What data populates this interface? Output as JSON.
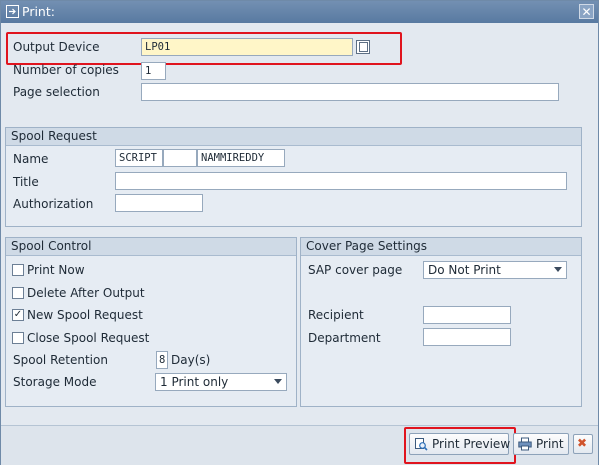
{
  "window": {
    "title": "Print:",
    "close_glyph": "✕"
  },
  "output_device": {
    "label": "Output Device",
    "value": "LP01"
  },
  "copies": {
    "label": "Number of copies",
    "value": "1"
  },
  "page_selection": {
    "label": "Page selection",
    "value": ""
  },
  "spool_request": {
    "heading": "Spool Request",
    "name_label": "Name",
    "name_part1": "SCRIPT",
    "name_part2": "",
    "name_part3": "NAMMIREDDY",
    "title_label": "Title",
    "title_value": "",
    "authorization_label": "Authorization",
    "authorization_value": ""
  },
  "spool_control": {
    "heading": "Spool Control",
    "options": [
      {
        "label": "Print Now",
        "checked": false,
        "mark": ""
      },
      {
        "label": "Delete After Output",
        "checked": false,
        "mark": ""
      },
      {
        "label": "New Spool Request",
        "checked": true,
        "mark": "✓"
      },
      {
        "label": "Close Spool Request",
        "checked": false,
        "mark": ""
      }
    ],
    "retention_label": "Spool Retention",
    "retention_value": "8",
    "retention_unit": "Day(s)",
    "storage_label": "Storage Mode",
    "storage_value": "1 Print only"
  },
  "cover_page": {
    "heading": "Cover Page Settings",
    "sap_cover_label": "SAP cover page",
    "sap_cover_value": "Do Not Print",
    "recipient_label": "Recipient",
    "recipient_value": "",
    "department_label": "Department",
    "department_value": ""
  },
  "footer": {
    "print_preview_label": "Print Preview",
    "print_label": "Print"
  },
  "colors": {
    "highlight": "#e0141e",
    "title_bar": "#587aa1",
    "required_field": "#fff6c8"
  }
}
